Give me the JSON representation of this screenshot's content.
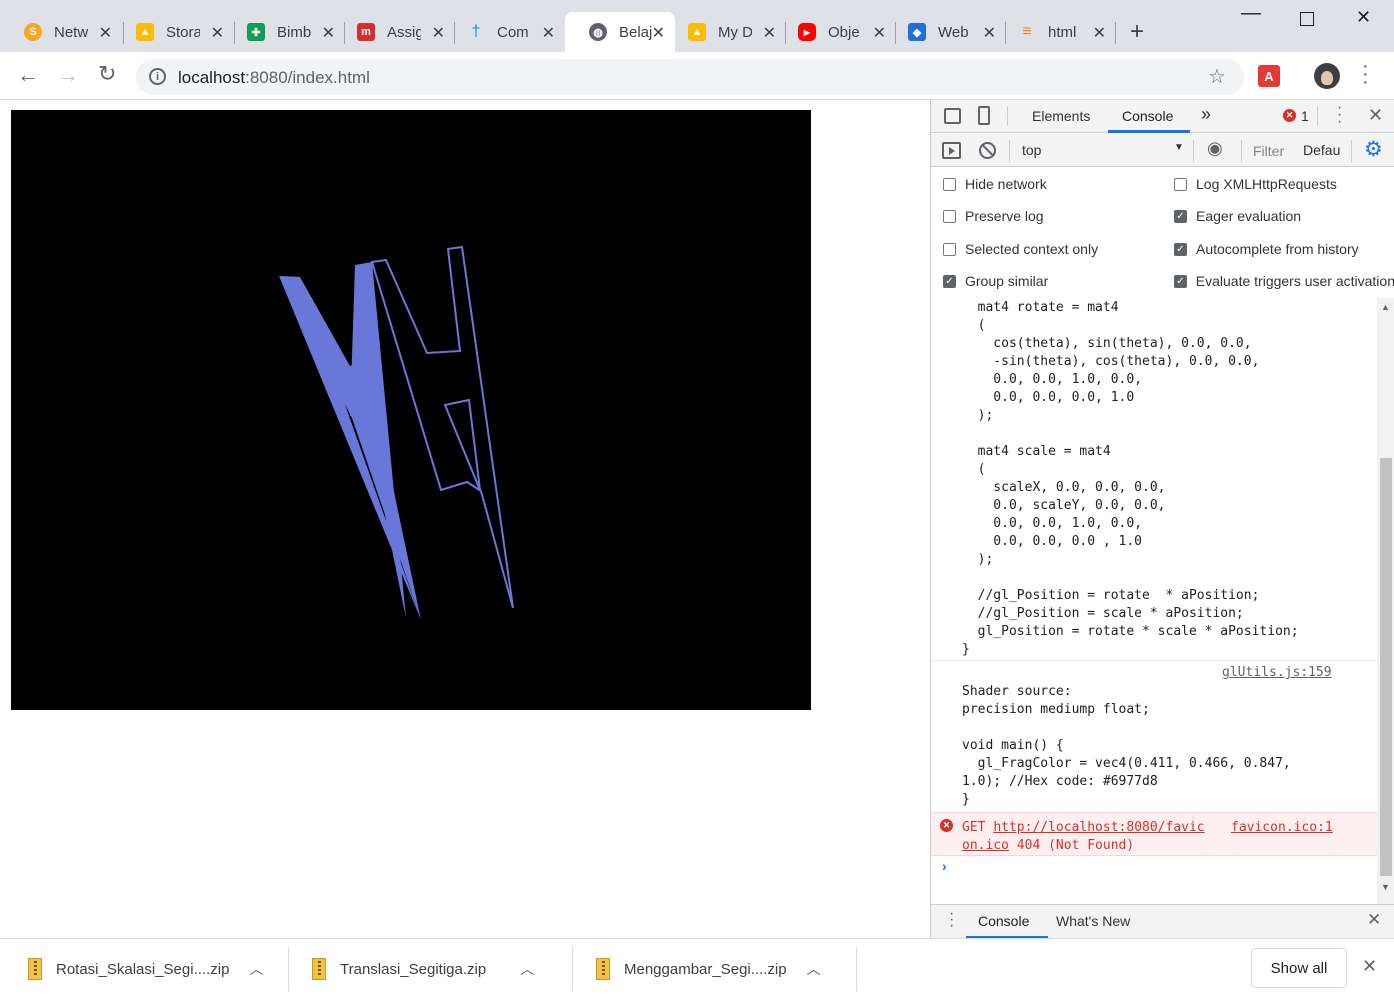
{
  "tabs": [
    {
      "title": "Netw",
      "icon": "shield-icon",
      "color": "#f5a623",
      "glyph": "S"
    },
    {
      "title": "Stora",
      "icon": "drive-icon",
      "color": "#1fa463",
      "glyph": "▲"
    },
    {
      "title": "Bimb",
      "icon": "sheets-icon",
      "color": "#0f9d58",
      "glyph": "✚"
    },
    {
      "title": "Assig",
      "icon": "m-icon",
      "color": "#d32f2f",
      "glyph": "m"
    },
    {
      "title": "Com",
      "icon": "cross-icon",
      "color": "#2aa5e0",
      "glyph": "†"
    },
    {
      "title": "Belaj",
      "icon": "globe-icon",
      "color": "#5f6368",
      "glyph": "◍"
    },
    {
      "title": "My D",
      "icon": "drive-icon",
      "color": "#1fa463",
      "glyph": "▲"
    },
    {
      "title": "Obje",
      "icon": "youtube-icon",
      "color": "#ff0000",
      "glyph": "▶"
    },
    {
      "title": "Web",
      "icon": "cube-icon",
      "color": "#1e6fd9",
      "glyph": "◆"
    },
    {
      "title": "html",
      "icon": "stack-icon",
      "color": "#f48024",
      "glyph": "≡"
    }
  ],
  "toolbar": {
    "url_host": "localhost",
    "url_port": ":8080",
    "url_path": "/index.html"
  },
  "devtools": {
    "tabs": {
      "elements": "Elements",
      "console": "Console",
      "more": "»"
    },
    "error_count": "1",
    "context": "top",
    "filter_placeholder": "Filter",
    "levels": "Defau",
    "settings_left": [
      {
        "label": "Hide network",
        "checked": false
      },
      {
        "label": "Preserve log",
        "checked": false
      },
      {
        "label": "Selected context only",
        "checked": false
      },
      {
        "label": "Group similar",
        "checked": true
      }
    ],
    "settings_right": [
      {
        "label": "Log XMLHttpRequests",
        "checked": false
      },
      {
        "label": "Eager evaluation",
        "checked": true
      },
      {
        "label": "Autocomplete from history",
        "checked": true
      },
      {
        "label": "Evaluate triggers user activation",
        "checked": true
      }
    ],
    "shader_vertex": "  mat4 rotate = mat4\n  (\n    cos(theta), sin(theta), 0.0, 0.0,\n    -sin(theta), cos(theta), 0.0, 0.0,\n    0.0, 0.0, 1.0, 0.0,\n    0.0, 0.0, 0.0, 1.0\n  );\n\n  mat4 scale = mat4\n  (\n    scaleX, 0.0, 0.0, 0.0,\n    0.0, scaleY, 0.0, 0.0,\n    0.0, 0.0, 1.0, 0.0,\n    0.0, 0.0, 0.0 , 1.0\n  );\n\n  //gl_Position = rotate  * aPosition;\n  //gl_Position = scale * aPosition;\n  gl_Position = rotate * scale * aPosition;\n}",
    "log_source": "glUtils.js:159",
    "shader_fragment": "Shader source:\nprecision mediump float;\n\nvoid main() {\n  gl_FragColor = vec4(0.411, 0.466, 0.847,\n1.0); //Hex code: #6977d8\n}",
    "error_get": "GET ",
    "error_url1": "http://localhost:8080/favic",
    "error_url2": "on.ico",
    "error_status": " 404 (Not Found)",
    "error_source1": "favicon.ico:1",
    "drawer_console": "Console",
    "drawer_whatsnew": "What's New"
  },
  "scene": {
    "fill_color": "#6977d8",
    "background": "#000000"
  },
  "downloads": {
    "items": [
      {
        "name": "Rotasi_Skalasi_Segi....zip"
      },
      {
        "name": "Translasi_Segitiga.zip"
      },
      {
        "name": "Menggambar_Segi....zip"
      }
    ],
    "show_all": "Show all"
  }
}
